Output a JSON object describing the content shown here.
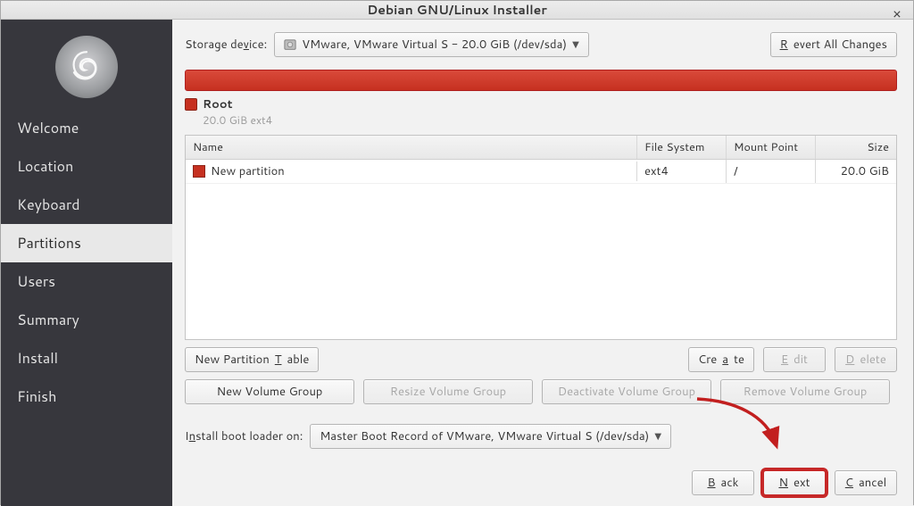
{
  "window": {
    "title": "Debian GNU/Linux Installer"
  },
  "sidebar": {
    "items": [
      {
        "label": "Welcome"
      },
      {
        "label": "Location"
      },
      {
        "label": "Keyboard"
      },
      {
        "label": "Partitions",
        "active": true
      },
      {
        "label": "Users"
      },
      {
        "label": "Summary"
      },
      {
        "label": "Install"
      },
      {
        "label": "Finish"
      }
    ]
  },
  "storage": {
    "label": "Storage device:",
    "selected": "VMware, VMware Virtual S - 20.0 GiB (/dev/sda)",
    "revert": "Revert All Changes"
  },
  "root": {
    "name": "Root",
    "sub": "20.0 GiB  ext4"
  },
  "table": {
    "headers": {
      "name": "Name",
      "fs": "File System",
      "mp": "Mount Point",
      "size": "Size"
    },
    "rows": [
      {
        "name": "New partition",
        "fs": "ext4",
        "mp": "/",
        "size": "20.0 GiB"
      }
    ]
  },
  "buttons": {
    "new_table": "New Partition Table",
    "create": "Create",
    "edit": "Edit",
    "delete": "Delete",
    "new_vg": "New Volume Group",
    "resize_vg": "Resize Volume Group",
    "deactivate_vg": "Deactivate Volume Group",
    "remove_vg": "Remove Volume Group"
  },
  "bootloader": {
    "label": "Install boot loader on:",
    "selected": "Master Boot Record of VMware, VMware Virtual S (/dev/sda)"
  },
  "footer": {
    "back": "Back",
    "next": "Next",
    "cancel": "Cancel"
  }
}
